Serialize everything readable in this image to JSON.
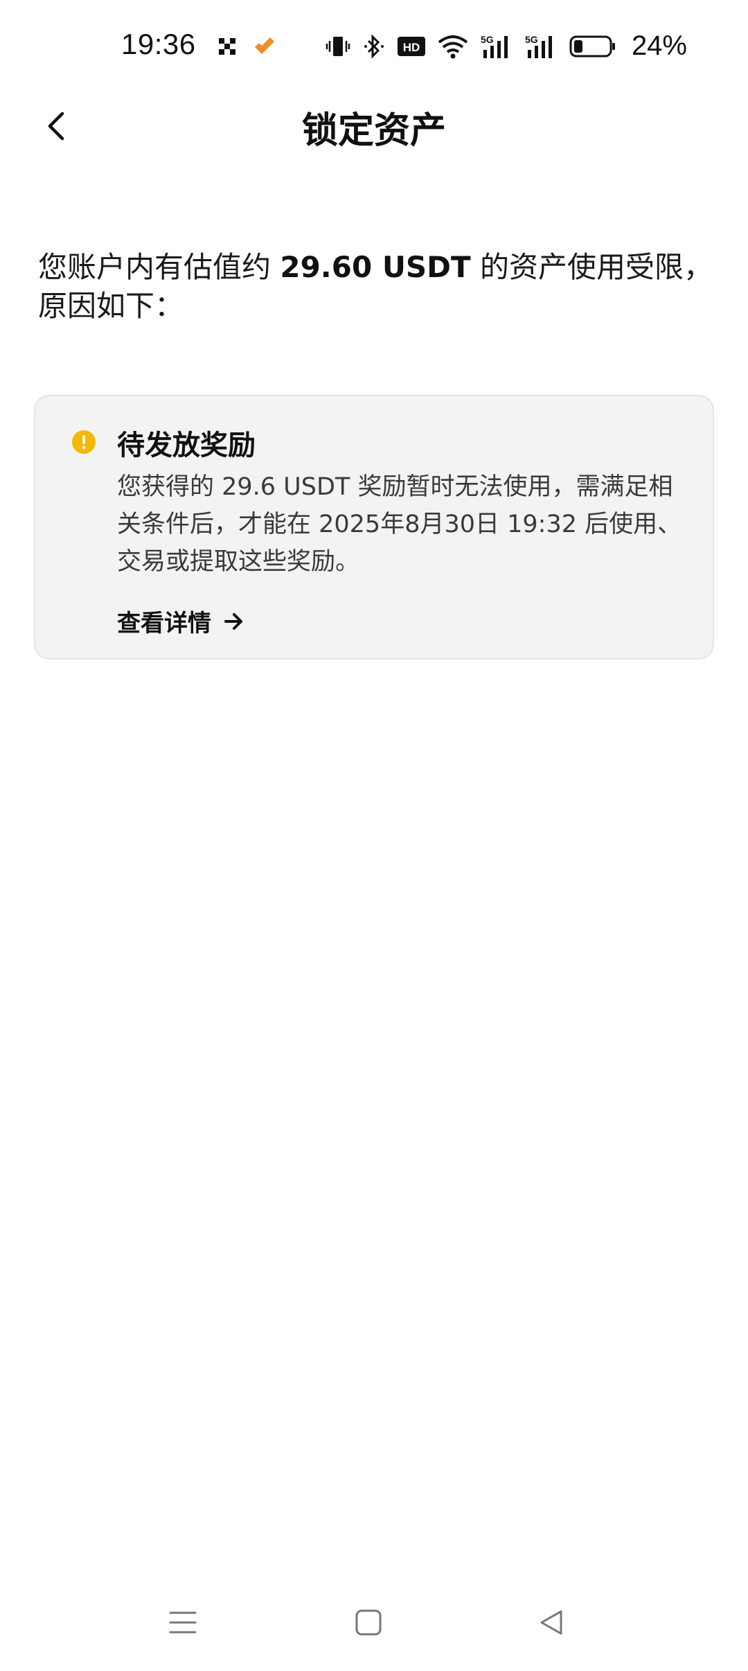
{
  "status_bar": {
    "time": "19:36",
    "battery_percent": "24%",
    "network_label_1": "5G",
    "network_label_2": "5G",
    "hd_label": "HD"
  },
  "header": {
    "title": "锁定资产"
  },
  "intro": {
    "prefix": "您账户内有估值约 ",
    "amount": "29.60 USDT",
    "suffix": " 的资产使用受限，原因如下："
  },
  "card": {
    "title": "待发放奖励",
    "description": "您获得的 29.6 USDT 奖励暂时无法使用，需满足相关条件后，才能在 2025年8月30日 19:32 后使用、交易或提取这些奖励。",
    "link_label": "查看详情"
  },
  "colors": {
    "warning": "#F5B800",
    "card_bg": "#F3F3F3",
    "app_icon_orange": "#F28C28"
  },
  "icons": {
    "back": "chevron-left-icon",
    "warning": "exclamation-circle-icon",
    "link_arrow": "arrow-right-icon",
    "nav_menu": "menu-icon",
    "nav_home": "home-square-icon",
    "nav_back": "triangle-back-icon"
  }
}
